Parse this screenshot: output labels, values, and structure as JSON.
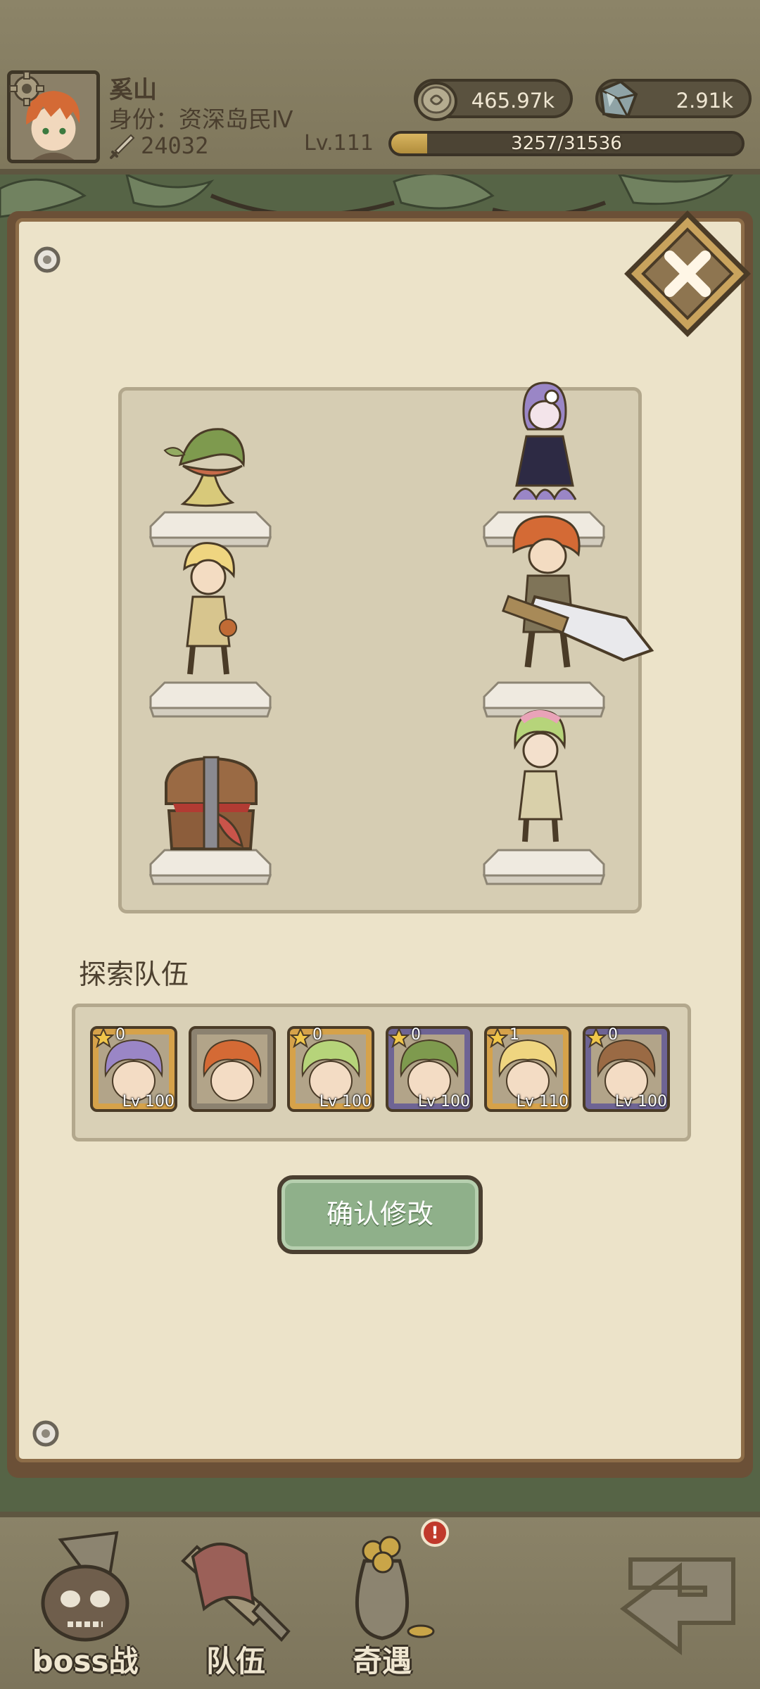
{
  "player": {
    "name": "奚山",
    "title": "身份：资深岛民Ⅳ",
    "power": "24032",
    "level": "Lv.111",
    "xp_text": "3257/31536",
    "xp_fraction": 0.103
  },
  "currencies": {
    "coins": "465.97k",
    "gems": "2.91k"
  },
  "formation": {
    "left_column": [
      "flytrap-plant",
      "blonde-hunter",
      "mimic-chest"
    ],
    "right_column": [
      "octopus-girl",
      "sword-hero",
      "flower-girl"
    ]
  },
  "team": {
    "label": "探索队伍",
    "members": [
      {
        "icon": "octopus-girl-portrait",
        "stars": "0",
        "level": "Lv 100",
        "frame": "gold"
      },
      {
        "icon": "sword-hero-portrait",
        "stars": "",
        "level": "",
        "frame": "plain"
      },
      {
        "icon": "flower-girl-portrait",
        "stars": "0",
        "level": "Lv 100",
        "frame": "gold"
      },
      {
        "icon": "flytrap-plant-portrait",
        "stars": "0",
        "level": "Lv 100",
        "frame": "purple"
      },
      {
        "icon": "blonde-hunter-portrait",
        "stars": "1",
        "level": "Lv 110",
        "frame": "gold"
      },
      {
        "icon": "mimic-chest-portrait",
        "stars": "0",
        "level": "Lv 100",
        "frame": "purple"
      }
    ]
  },
  "confirm_label": "确认修改",
  "nav": {
    "boss": "boss战",
    "team": "队伍",
    "adventure": "奇遇",
    "alert": "!"
  },
  "colors": {
    "parchment": "#ece3c9",
    "confirm_green": "#8fb08a",
    "frame_gold": "#d6a24a",
    "frame_purple": "#6e6494"
  }
}
